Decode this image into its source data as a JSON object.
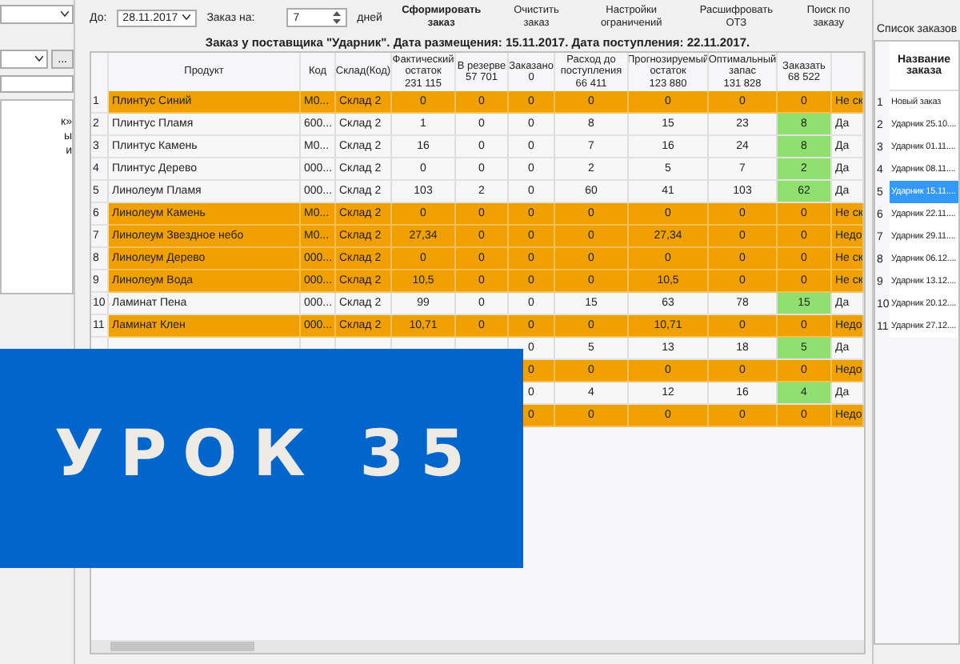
{
  "left_panel": {
    "browse_button": "...",
    "tree_items": [
      "к»",
      "ы",
      "и"
    ]
  },
  "toolbar": {
    "date_label": "До:",
    "date": "28.11.2017",
    "order_for_label": "Заказ на:",
    "days": "7",
    "days_unit": "дней",
    "buttons": [
      {
        "label": "Сформировать заказ",
        "primary": true
      },
      {
        "label": "Очистить заказ",
        "primary": false
      },
      {
        "label": "Настройки ограничений",
        "primary": false
      },
      {
        "label": "Расшифровать ОТЗ",
        "primary": false
      },
      {
        "label": "Поиск по заказу",
        "primary": false
      }
    ]
  },
  "title": "Заказ у поставщика \"Ударник\". Дата размещения: 15.11.2017. Дата поступления: 22.11.2017.",
  "table": {
    "columns": [
      {
        "label": "Продукт"
      },
      {
        "label": "Код"
      },
      {
        "label": "Склад(Код)"
      },
      {
        "label": "Фактический остаток",
        "total": "231 115"
      },
      {
        "label": "В резерве",
        "total": "57 701"
      },
      {
        "label": "Заказано",
        "total": "0"
      },
      {
        "label": "Расход до поступления",
        "total": "66 411"
      },
      {
        "label": "Прогнозируемый остаток",
        "total": "123 880"
      },
      {
        "label": "Оптимальный запас",
        "total": "131 828"
      },
      {
        "label": "Заказать",
        "total": "68 522"
      }
    ],
    "rows": [
      {
        "kind": "shortage",
        "num": "1",
        "product": "Плинтус Синий",
        "code": "М0...",
        "warehouse": "Склад 2",
        "actual": "0",
        "reserve": "0",
        "ordered": "0",
        "consumption": "0",
        "forecast": "0",
        "optimal": "0",
        "order": "0",
        "status": "Не ск"
      },
      {
        "kind": "order",
        "num": "2",
        "product": "Плинтус Пламя",
        "code": "600...",
        "warehouse": "Склад 2",
        "actual": "1",
        "reserve": "0",
        "ordered": "0",
        "consumption": "8",
        "forecast": "15",
        "optimal": "23",
        "order": "8",
        "status": "Да"
      },
      {
        "kind": "order",
        "num": "3",
        "product": "Плинтус Камень",
        "code": "М0...",
        "warehouse": "Склад 2",
        "actual": "16",
        "reserve": "0",
        "ordered": "0",
        "consumption": "7",
        "forecast": "16",
        "optimal": "24",
        "order": "8",
        "status": "Да"
      },
      {
        "kind": "order",
        "num": "4",
        "product": "Плинтус Дерево",
        "code": "000...",
        "warehouse": "Склад 2",
        "actual": "0",
        "reserve": "0",
        "ordered": "0",
        "consumption": "2",
        "forecast": "5",
        "optimal": "7",
        "order": "2",
        "status": "Да"
      },
      {
        "kind": "order",
        "num": "5",
        "product": "Линолеум Пламя",
        "code": "000...",
        "warehouse": "Склад 2",
        "actual": "103",
        "reserve": "2",
        "ordered": "0",
        "consumption": "60",
        "forecast": "41",
        "optimal": "103",
        "order": "62",
        "status": "Да"
      },
      {
        "kind": "shortage",
        "num": "6",
        "product": "Линолеум Камень",
        "code": "М0...",
        "warehouse": "Склад 2",
        "actual": "0",
        "reserve": "0",
        "ordered": "0",
        "consumption": "0",
        "forecast": "0",
        "optimal": "0",
        "order": "0",
        "status": "Не ск"
      },
      {
        "kind": "shortage",
        "num": "7",
        "product": "Линолеум Звездное небо",
        "code": "М0...",
        "warehouse": "Склад 2",
        "actual": "27,34",
        "reserve": "0",
        "ordered": "0",
        "consumption": "0",
        "forecast": "27,34",
        "optimal": "0",
        "order": "0",
        "status": "Недо"
      },
      {
        "kind": "shortage",
        "num": "8",
        "product": "Линолеум Дерево",
        "code": "000...",
        "warehouse": "Склад 2",
        "actual": "0",
        "reserve": "0",
        "ordered": "0",
        "consumption": "0",
        "forecast": "0",
        "optimal": "0",
        "order": "0",
        "status": "Не ск"
      },
      {
        "kind": "shortage",
        "num": "9",
        "product": "Линолеум Вода",
        "code": "000...",
        "warehouse": "Склад 2",
        "actual": "10,5",
        "reserve": "0",
        "ordered": "0",
        "consumption": "0",
        "forecast": "10,5",
        "optimal": "0",
        "order": "0",
        "status": "Не ск"
      },
      {
        "kind": "order",
        "num": "10",
        "product": "Ламинат Пена",
        "code": "000...",
        "warehouse": "Склад 2",
        "actual": "99",
        "reserve": "0",
        "ordered": "0",
        "consumption": "15",
        "forecast": "63",
        "optimal": "78",
        "order": "15",
        "status": "Да"
      },
      {
        "kind": "shortage",
        "num": "11",
        "product": "Ламинат Клен",
        "code": "000...",
        "warehouse": "Склад 2",
        "actual": "10,71",
        "reserve": "0",
        "ordered": "0",
        "consumption": "0",
        "forecast": "10,71",
        "optimal": "0",
        "order": "0",
        "status": "Недо"
      },
      {
        "kind": "order",
        "ordered": "0",
        "consumption": "5",
        "forecast": "13",
        "optimal": "18",
        "order": "5",
        "status": "Да"
      },
      {
        "kind": "shortage",
        "ordered": "0",
        "consumption": "0",
        "forecast": "0",
        "optimal": "0",
        "order": "0",
        "status": "Недо"
      },
      {
        "kind": "order",
        "ordered": "0",
        "consumption": "4",
        "forecast": "12",
        "optimal": "16",
        "order": "4",
        "status": "Да"
      },
      {
        "kind": "shortage",
        "ordered": "0",
        "consumption": "0",
        "forecast": "0",
        "optimal": "0",
        "order": "0",
        "status": "Недо"
      }
    ]
  },
  "orders_panel": {
    "title": "Список заказов",
    "column": "Название заказа",
    "items": [
      {
        "num": "1",
        "name": "Новый заказ",
        "selected": false
      },
      {
        "num": "2",
        "name": "Ударник 25.10....",
        "selected": false
      },
      {
        "num": "3",
        "name": "Ударник 01.11....",
        "selected": false
      },
      {
        "num": "4",
        "name": "Ударник 08.11....",
        "selected": false
      },
      {
        "num": "5",
        "name": "Ударник 15.11....",
        "selected": true
      },
      {
        "num": "6",
        "name": "Ударник 22.11....",
        "selected": false
      },
      {
        "num": "7",
        "name": "Ударник 29.11....",
        "selected": false
      },
      {
        "num": "8",
        "name": "Ударник 06.12....",
        "selected": false
      },
      {
        "num": "9",
        "name": "Ударник 13.12....",
        "selected": false
      },
      {
        "num": "10",
        "name": "Ударник 20.12....",
        "selected": false
      },
      {
        "num": "11",
        "name": "Ударник 27.12....",
        "selected": false
      }
    ]
  },
  "banner": {
    "text": "УРОК 35"
  }
}
